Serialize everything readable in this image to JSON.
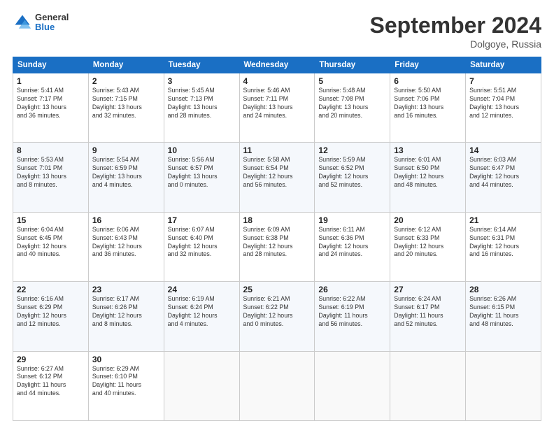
{
  "logo": {
    "general": "General",
    "blue": "Blue"
  },
  "title": "September 2024",
  "location": "Dolgoye, Russia",
  "days_of_week": [
    "Sunday",
    "Monday",
    "Tuesday",
    "Wednesday",
    "Thursday",
    "Friday",
    "Saturday"
  ],
  "weeks": [
    [
      {
        "day": "1",
        "info": "Sunrise: 5:41 AM\nSunset: 7:17 PM\nDaylight: 13 hours\nand 36 minutes."
      },
      {
        "day": "2",
        "info": "Sunrise: 5:43 AM\nSunset: 7:15 PM\nDaylight: 13 hours\nand 32 minutes."
      },
      {
        "day": "3",
        "info": "Sunrise: 5:45 AM\nSunset: 7:13 PM\nDaylight: 13 hours\nand 28 minutes."
      },
      {
        "day": "4",
        "info": "Sunrise: 5:46 AM\nSunset: 7:11 PM\nDaylight: 13 hours\nand 24 minutes."
      },
      {
        "day": "5",
        "info": "Sunrise: 5:48 AM\nSunset: 7:08 PM\nDaylight: 13 hours\nand 20 minutes."
      },
      {
        "day": "6",
        "info": "Sunrise: 5:50 AM\nSunset: 7:06 PM\nDaylight: 13 hours\nand 16 minutes."
      },
      {
        "day": "7",
        "info": "Sunrise: 5:51 AM\nSunset: 7:04 PM\nDaylight: 13 hours\nand 12 minutes."
      }
    ],
    [
      {
        "day": "8",
        "info": "Sunrise: 5:53 AM\nSunset: 7:01 PM\nDaylight: 13 hours\nand 8 minutes."
      },
      {
        "day": "9",
        "info": "Sunrise: 5:54 AM\nSunset: 6:59 PM\nDaylight: 13 hours\nand 4 minutes."
      },
      {
        "day": "10",
        "info": "Sunrise: 5:56 AM\nSunset: 6:57 PM\nDaylight: 13 hours\nand 0 minutes."
      },
      {
        "day": "11",
        "info": "Sunrise: 5:58 AM\nSunset: 6:54 PM\nDaylight: 12 hours\nand 56 minutes."
      },
      {
        "day": "12",
        "info": "Sunrise: 5:59 AM\nSunset: 6:52 PM\nDaylight: 12 hours\nand 52 minutes."
      },
      {
        "day": "13",
        "info": "Sunrise: 6:01 AM\nSunset: 6:50 PM\nDaylight: 12 hours\nand 48 minutes."
      },
      {
        "day": "14",
        "info": "Sunrise: 6:03 AM\nSunset: 6:47 PM\nDaylight: 12 hours\nand 44 minutes."
      }
    ],
    [
      {
        "day": "15",
        "info": "Sunrise: 6:04 AM\nSunset: 6:45 PM\nDaylight: 12 hours\nand 40 minutes."
      },
      {
        "day": "16",
        "info": "Sunrise: 6:06 AM\nSunset: 6:43 PM\nDaylight: 12 hours\nand 36 minutes."
      },
      {
        "day": "17",
        "info": "Sunrise: 6:07 AM\nSunset: 6:40 PM\nDaylight: 12 hours\nand 32 minutes."
      },
      {
        "day": "18",
        "info": "Sunrise: 6:09 AM\nSunset: 6:38 PM\nDaylight: 12 hours\nand 28 minutes."
      },
      {
        "day": "19",
        "info": "Sunrise: 6:11 AM\nSunset: 6:36 PM\nDaylight: 12 hours\nand 24 minutes."
      },
      {
        "day": "20",
        "info": "Sunrise: 6:12 AM\nSunset: 6:33 PM\nDaylight: 12 hours\nand 20 minutes."
      },
      {
        "day": "21",
        "info": "Sunrise: 6:14 AM\nSunset: 6:31 PM\nDaylight: 12 hours\nand 16 minutes."
      }
    ],
    [
      {
        "day": "22",
        "info": "Sunrise: 6:16 AM\nSunset: 6:29 PM\nDaylight: 12 hours\nand 12 minutes."
      },
      {
        "day": "23",
        "info": "Sunrise: 6:17 AM\nSunset: 6:26 PM\nDaylight: 12 hours\nand 8 minutes."
      },
      {
        "day": "24",
        "info": "Sunrise: 6:19 AM\nSunset: 6:24 PM\nDaylight: 12 hours\nand 4 minutes."
      },
      {
        "day": "25",
        "info": "Sunrise: 6:21 AM\nSunset: 6:22 PM\nDaylight: 12 hours\nand 0 minutes."
      },
      {
        "day": "26",
        "info": "Sunrise: 6:22 AM\nSunset: 6:19 PM\nDaylight: 11 hours\nand 56 minutes."
      },
      {
        "day": "27",
        "info": "Sunrise: 6:24 AM\nSunset: 6:17 PM\nDaylight: 11 hours\nand 52 minutes."
      },
      {
        "day": "28",
        "info": "Sunrise: 6:26 AM\nSunset: 6:15 PM\nDaylight: 11 hours\nand 48 minutes."
      }
    ],
    [
      {
        "day": "29",
        "info": "Sunrise: 6:27 AM\nSunset: 6:12 PM\nDaylight: 11 hours\nand 44 minutes."
      },
      {
        "day": "30",
        "info": "Sunrise: 6:29 AM\nSunset: 6:10 PM\nDaylight: 11 hours\nand 40 minutes."
      },
      {
        "day": "",
        "info": ""
      },
      {
        "day": "",
        "info": ""
      },
      {
        "day": "",
        "info": ""
      },
      {
        "day": "",
        "info": ""
      },
      {
        "day": "",
        "info": ""
      }
    ]
  ]
}
